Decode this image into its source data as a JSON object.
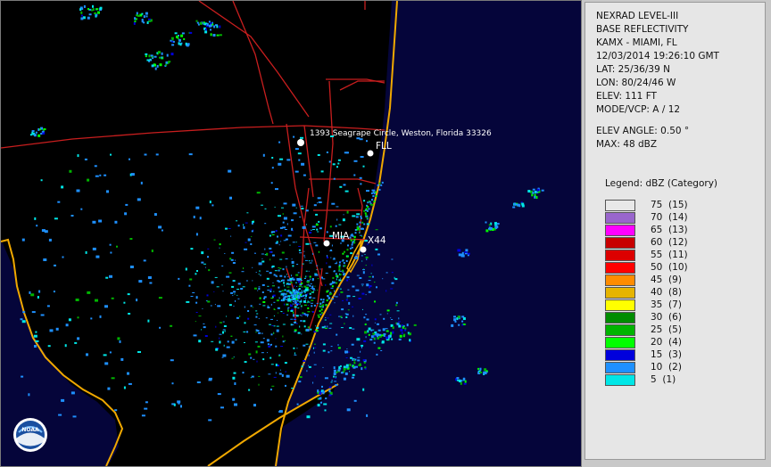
{
  "header": {
    "product": "NEXRAD LEVEL-III",
    "type": "BASE REFLECTIVITY",
    "station": "KAMX - MIAMI, FL",
    "datetime": "12/03/2014 19:26:10 GMT",
    "lat": "LAT: 25/36/39 N",
    "lon": "LON: 80/24/46 W",
    "elev": "ELEV: 111 FT",
    "mode": "MODE/VCP: A / 12",
    "elev_angle": "ELEV ANGLE: 0.50 °",
    "max": "MAX: 48 dBZ"
  },
  "legend": {
    "title": "Legend: dBZ (Category)",
    "items": [
      {
        "label": "75  (15)",
        "color": "#e8e8e8"
      },
      {
        "label": "70  (14)",
        "color": "#9966cc"
      },
      {
        "label": "65  (13)",
        "color": "#ff00ff"
      },
      {
        "label": "60  (12)",
        "color": "#c80000"
      },
      {
        "label": "55  (11)",
        "color": "#dc0000"
      },
      {
        "label": "50  (10)",
        "color": "#ff0000"
      },
      {
        "label": "45  (9)",
        "color": "#ff8c00"
      },
      {
        "label": "40  (8)",
        "color": "#e6b400"
      },
      {
        "label": "35  (7)",
        "color": "#ffff00"
      },
      {
        "label": "30  (6)",
        "color": "#008c00"
      },
      {
        "label": "25  (5)",
        "color": "#00b400"
      },
      {
        "label": "20  (4)",
        "color": "#00ff00"
      },
      {
        "label": "15  (3)",
        "color": "#0000dc"
      },
      {
        "label": "10  (2)",
        "color": "#1e90ff"
      },
      {
        "label": "5  (1)",
        "color": "#00e6e6"
      }
    ]
  },
  "map": {
    "labels": {
      "address": "1393 Seagrape Circle, Weston, Florida 33326",
      "fll": "FLL",
      "mia": "MIA",
      "x44": "X44"
    },
    "logo": "NOAA",
    "colors": {
      "ocean": "#05053a",
      "land": "#000000",
      "coastline": "#f0a800",
      "roads": "#c81e1e"
    }
  }
}
